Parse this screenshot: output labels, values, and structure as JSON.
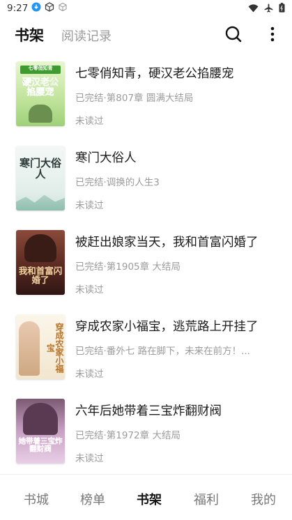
{
  "status_bar": {
    "time": "9:27",
    "icons": [
      "download-badge-icon",
      "box-icon",
      "box-outline-icon",
      "wifi-icon",
      "airplane-icon",
      "battery-icon"
    ]
  },
  "header": {
    "tabs": [
      {
        "label": "书架",
        "active": true
      },
      {
        "label": "阅读记录",
        "active": false
      }
    ],
    "search_icon": "search-icon",
    "more_icon": "more-vertical-icon"
  },
  "books": [
    {
      "title": "七零俏知青，硬汉老公掐腰宠",
      "status": "已完结·第807章 圆满大结局",
      "read": "未读过",
      "cover_text": "硬汉老公掐腰宠",
      "cover_badge": "七零俏知青",
      "cover_bg": "#cfe9a8",
      "cover_accent": "#3f9b2f"
    },
    {
      "title": "寒门大俗人",
      "status": "已完结·调换的人生3",
      "read": "未读过",
      "cover_text": "寒门大俗人",
      "cover_bg": "#e8f1ef",
      "cover_accent": "#2c3a38"
    },
    {
      "title": "被赶出娘家当天，我和首富闪婚了",
      "status": "已完结·第1905章 大结局",
      "read": "未读过",
      "cover_text": "我和首富闪婚了",
      "cover_bg": "#5b2a22",
      "cover_accent": "#f2d4a0"
    },
    {
      "title": "穿成农家小福宝，逃荒路上开挂了",
      "status": "已完结·番外七 路在脚下，未来在前方！...",
      "read": "未读过",
      "cover_text": "穿成农家小福宝",
      "cover_bg": "#f6efe0",
      "cover_accent": "#b8742a"
    },
    {
      "title": "六年后她带着三宝炸翻财阀",
      "status": "已完结·第1972章 大结局",
      "read": "未读过",
      "cover_text": "她带着三宝炸翻财阀",
      "cover_bg": "#d9b7d8",
      "cover_accent": "#d63c8f"
    }
  ],
  "bottom_nav": [
    {
      "label": "书城",
      "active": false
    },
    {
      "label": "榜单",
      "active": false
    },
    {
      "label": "书架",
      "active": true
    },
    {
      "label": "福利",
      "active": false
    },
    {
      "label": "我的",
      "active": false
    }
  ]
}
